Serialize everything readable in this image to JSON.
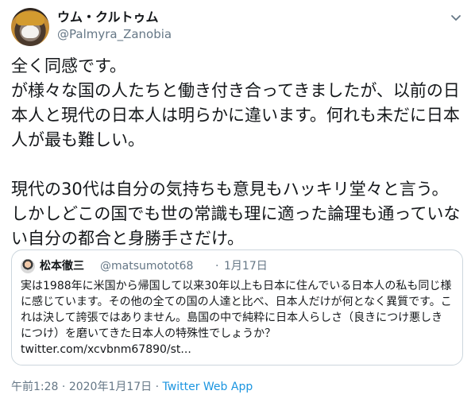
{
  "author": {
    "display_name": "ウム・クルトゥム",
    "handle": "@Palmyra_Zanobia"
  },
  "tweet_text": "全く同感です。\nが様々な国の人たちと働き付き合ってきましたが、以前の日本人と現代の日本人は明らかに違います。何れも未だに日本人が最も難しい。\n\n現代の30代は自分の気持ちも意見もハッキリ堂々と言う。しかしどこの国でも世の常識も理に適った論理も通っていない自分の都合と身勝手さだけ。",
  "quoted_tweet": {
    "display_name": "松本徹三",
    "handle": "@matsumotot68",
    "separator": "·",
    "date": "1月17日",
    "text": "実は1988年に米国から帰国して以来30年以上も日本に住んでいる日本人の私も同じ様に感じています。その他の全ての国の人達と比べ、日本人だけが何となく異質です。これは決して誇張ではありません。島国の中で純粋に日本人らしさ（良きにつけ悪しきにつけ）を磨いてきた日本人の特殊性でしょうか？\ntwitter.com/xcvbnm67890/st..."
  },
  "meta": {
    "time": "午前1:28",
    "separator1": " · ",
    "date": "2020年1月17日",
    "separator2": " · ",
    "source": "Twitter Web App"
  },
  "icons": {
    "menu": "chevron-down-icon"
  },
  "colors": {
    "text": "#14171a",
    "secondary": "#657786",
    "link": "#1b95e0",
    "border": "#ccd6dd"
  }
}
